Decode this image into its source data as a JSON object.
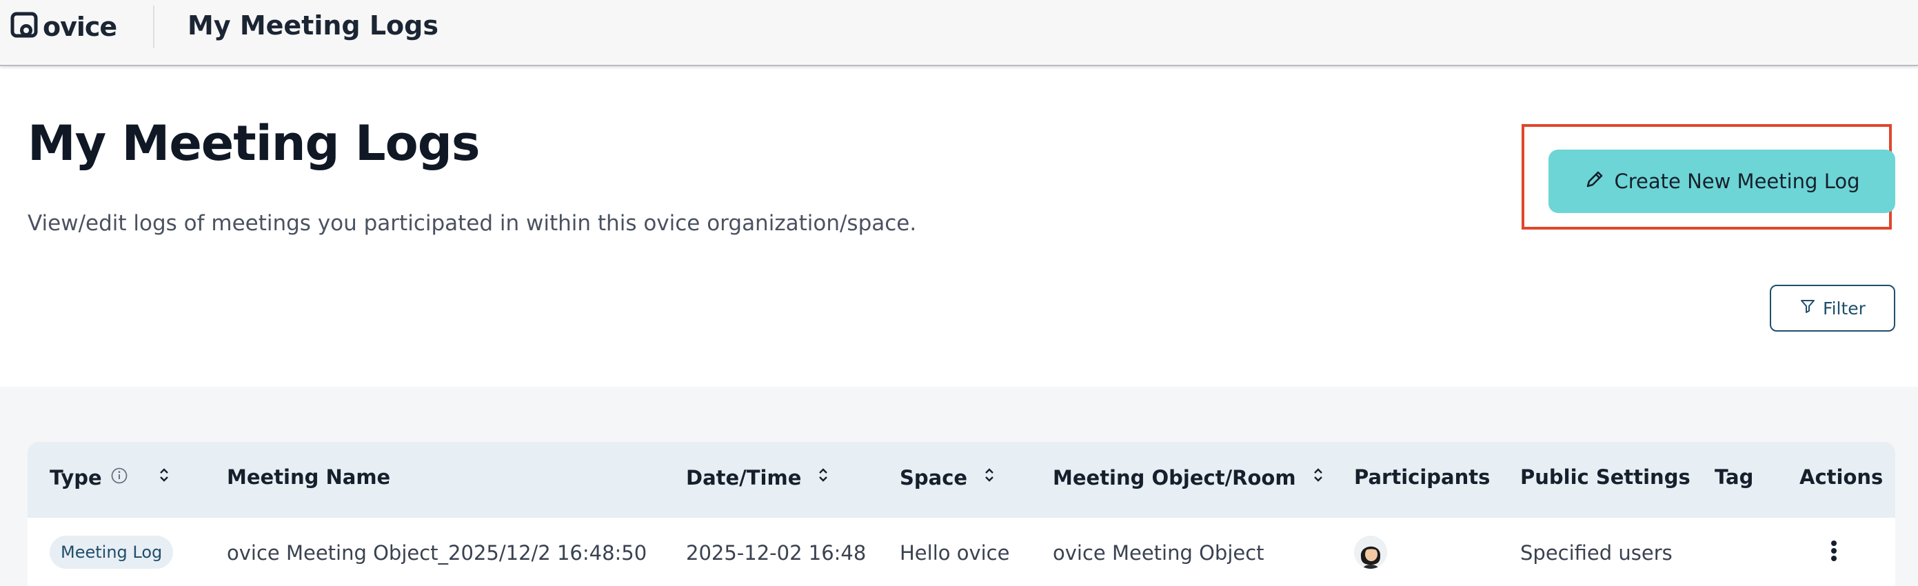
{
  "app": {
    "logo_text": "ovice",
    "topbar_title": "My Meeting Logs"
  },
  "header": {
    "title": "My Meeting Logs",
    "description": "View/edit logs of meetings you participated in within this ovice organization/space.",
    "create_button_label": "Create New Meeting Log",
    "filter_button_label": "Filter"
  },
  "table": {
    "columns": [
      {
        "label": "Type",
        "sortable": true,
        "info": true
      },
      {
        "label": "Meeting Name",
        "sortable": false
      },
      {
        "label": "Date/Time",
        "sortable": true
      },
      {
        "label": "Space",
        "sortable": true
      },
      {
        "label": "Meeting Object/Room",
        "sortable": true
      },
      {
        "label": "Participants",
        "sortable": false
      },
      {
        "label": "Public Settings",
        "sortable": false
      },
      {
        "label": "Tag",
        "sortable": false
      },
      {
        "label": "Actions",
        "sortable": false
      }
    ],
    "rows": [
      {
        "type": "Meeting Log",
        "meeting_name": "ovice Meeting Object_2025/12/2 16:48:50",
        "datetime": "2025-12-02 16:48",
        "space": "Hello ovice",
        "room": "ovice Meeting Object",
        "participants_icon": "user-avatar",
        "public_settings": "Specified users",
        "tag": "",
        "actions_icon": "more-vertical-icon"
      }
    ]
  },
  "colors": {
    "primary_button": "#6dd5d5",
    "highlight_border": "#e0462a",
    "table_header_bg": "#e7eef4",
    "accent_text": "#1f4e6b"
  }
}
